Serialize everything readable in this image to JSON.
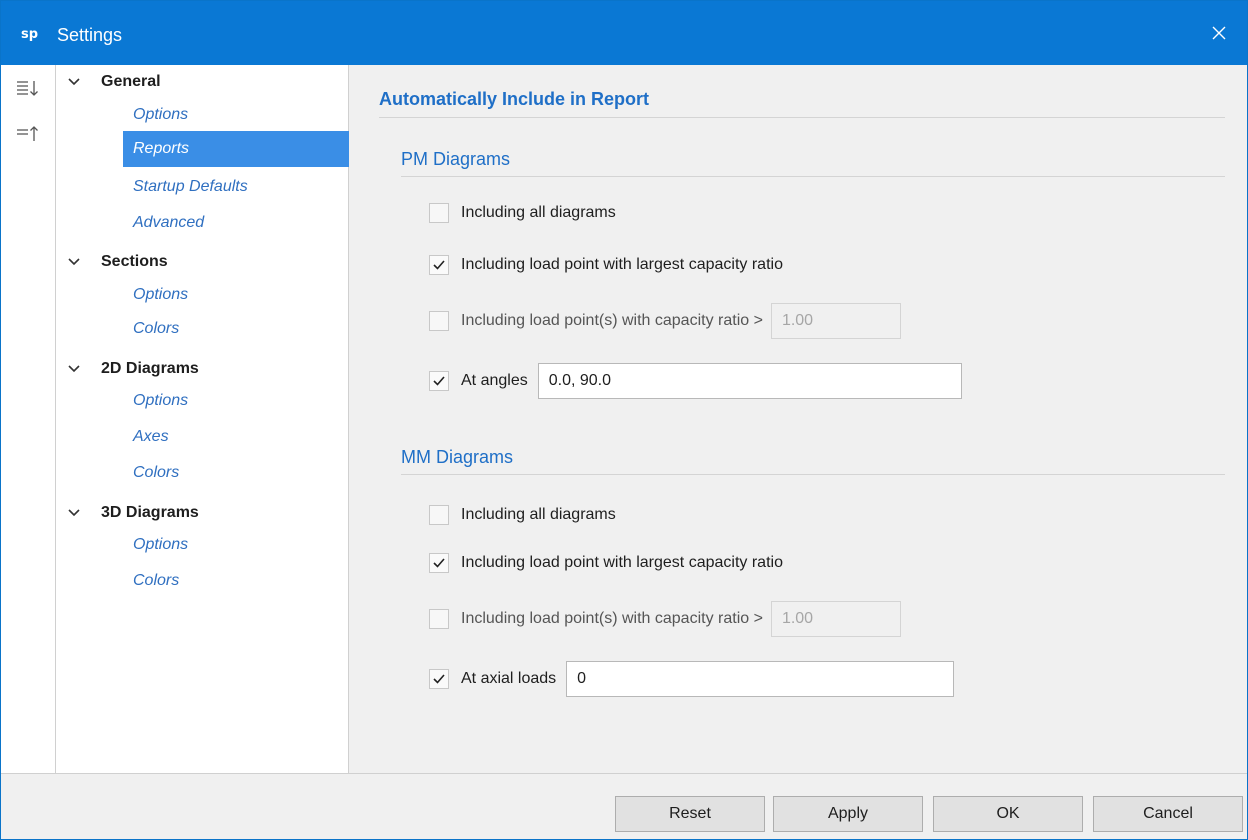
{
  "window": {
    "app_logo": "sp",
    "title": "Settings",
    "close_icon": "close-icon"
  },
  "toolbar_strip": {
    "expand_icon": "expand-all-icon",
    "collapse_icon": "collapse-all-icon"
  },
  "tree": {
    "groups": [
      {
        "label": "General",
        "items": [
          "Options",
          "Reports",
          "Startup Defaults",
          "Advanced"
        ]
      },
      {
        "label": "Sections",
        "items": [
          "Options",
          "Colors"
        ]
      },
      {
        "label": "2D Diagrams",
        "items": [
          "Options",
          "Axes",
          "Colors"
        ]
      },
      {
        "label": "3D Diagrams",
        "items": [
          "Options",
          "Colors"
        ]
      }
    ],
    "selected": "Reports"
  },
  "content": {
    "heading": "Automatically Include in Report",
    "pm": {
      "title": "PM Diagrams",
      "all_label": "Including all diagrams",
      "all_checked": false,
      "largest_label": "Including load point with largest capacity ratio",
      "largest_checked": true,
      "ratio_label": "Including load point(s) with capacity ratio >",
      "ratio_checked": false,
      "ratio_value": "1.00",
      "angles_label": "At angles",
      "angles_checked": true,
      "angles_value": "0.0, 90.0"
    },
    "mm": {
      "title": "MM Diagrams",
      "all_label": "Including all diagrams",
      "all_checked": false,
      "largest_label": "Including load point with largest capacity ratio",
      "largest_checked": true,
      "ratio_label": "Including load point(s) with capacity ratio >",
      "ratio_checked": false,
      "ratio_value": "1.00",
      "axial_label": "At axial loads",
      "axial_checked": true,
      "axial_value": "0"
    }
  },
  "footer": {
    "reset": "Reset",
    "apply": "Apply",
    "ok": "OK",
    "cancel": "Cancel"
  },
  "colors": {
    "titlebar": "#0a78d4",
    "selection": "#3a8ee6",
    "link_text": "#2f6fc0",
    "section_title": "#1f6fc7"
  }
}
